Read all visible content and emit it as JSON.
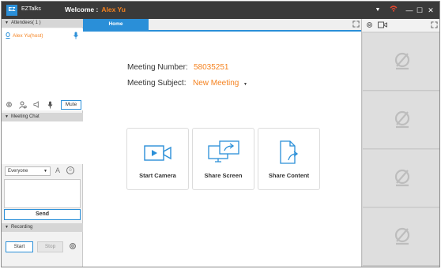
{
  "titlebar": {
    "logo": "EZ",
    "app_name": "EZTalks",
    "welcome_label": "Welcome :",
    "user_name": "Alex Yu",
    "icons": [
      "dropdown-icon",
      "wifi-icon",
      "minimize-icon",
      "maximize-icon",
      "close-icon"
    ],
    "dropdown_glyph": "▼",
    "minimize_glyph": "—",
    "maximize_glyph": "☐",
    "close_glyph": "✕"
  },
  "attendees": {
    "header": "Attendees( 1 )",
    "items": [
      {
        "name": "Alex Yu(host)"
      }
    ],
    "mute_label": "Mute"
  },
  "chat": {
    "header": "Meeting Chat",
    "recipient": "Everyone",
    "font_glyph": "A",
    "send_label": "Send"
  },
  "recording": {
    "header": "Recording",
    "start_label": "Start",
    "stop_label": "Stop"
  },
  "main": {
    "tab_label": "Home",
    "meeting_number_label": "Meeting Number:",
    "meeting_number": "58035251",
    "meeting_subject_label": "Meeting Subject:",
    "meeting_subject": "New Meeting",
    "cards": [
      {
        "label": "Start Camera",
        "icon": "camera-icon"
      },
      {
        "label": "Share Screen",
        "icon": "share-screen-icon"
      },
      {
        "label": "Share Content",
        "icon": "share-content-icon"
      }
    ]
  },
  "video_panel": {
    "tiles": [
      "no-video-icon",
      "no-video-icon",
      "no-video-icon",
      "no-video-icon"
    ]
  },
  "colors": {
    "accent": "#2a8fd8",
    "user_name": "#f5821f",
    "titlebar_bg": "#3a3a3a",
    "wifi": "#e8472f"
  }
}
